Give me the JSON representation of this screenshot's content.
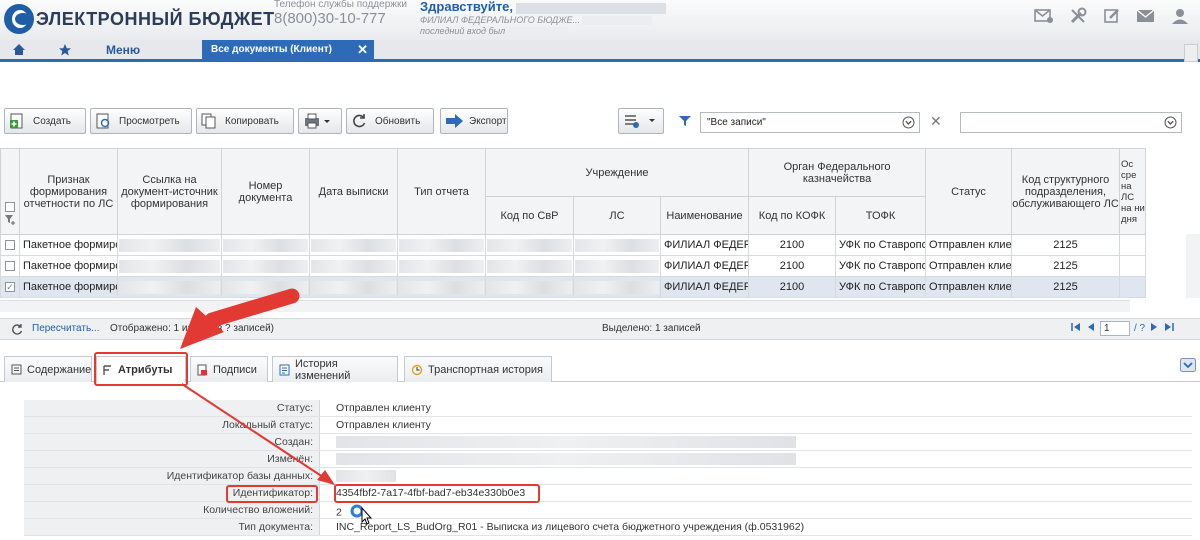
{
  "header": {
    "logo_text": "ЭЛЕКТРОННЫЙ БЮДЖЕТ",
    "support_label": "Телефон службы поддержки",
    "support_phone": "8(800)30-10-777",
    "greeting": "Здравствуйте,",
    "org": "ФИЛИАЛ ФЕДЕРАЛЬНОГО БЮДЖЕ...",
    "last_login_label": "последний вход был"
  },
  "nav": {
    "menu_label": "Меню",
    "active_tab_label": "Все документы (Клиент)",
    "close_glyph": "✕"
  },
  "toolbar": {
    "create": "Создать",
    "view": "Просмотреть",
    "copy": "Копировать",
    "refresh": "Обновить",
    "export": "Экспорт",
    "filter_value": "\"Все записи\"",
    "clear_glyph": "✕"
  },
  "grid": {
    "headers": {
      "sign": "Признак формирования отчетности по ЛС",
      "link": "Ссылка на документ-источник формирования",
      "doc_number": "Номер документа",
      "date": "Дата выписки",
      "report_type": "Тип отчета",
      "institution": "Учреждение",
      "svr_code": "Код по СвР",
      "ls": "ЛС",
      "name": "Наименование",
      "treasury": "Орган Федерального казначейства",
      "kofk_code": "Код по КОФК",
      "tofk": "ТОФК",
      "status": "Статус",
      "struct_code": "Код структурного подразделения, обслуживающего ЛС",
      "extra": "Ос сре на ЛС на ни дня"
    },
    "rows": [
      {
        "sign": "Пакетное формиро",
        "name": "ФИЛИАЛ ФЕДЕР",
        "kofk": "2100",
        "tofk": "УФК по Ставропо",
        "status": "Отправлен клиен",
        "struct": "2125",
        "checked": false
      },
      {
        "sign": "Пакетное формиро",
        "name": "ФИЛИАЛ ФЕДЕР",
        "kofk": "2100",
        "tofk": "УФК по Ставропо",
        "status": "Отправлен клиен",
        "struct": "2125",
        "checked": false
      },
      {
        "sign": "Пакетное формиро",
        "name": "ФИЛИАЛ ФЕДЕР",
        "kofk": "2100",
        "tofk": "УФК по Ставропо",
        "status": "Отправлен клиен",
        "struct": "2125",
        "checked": true
      }
    ]
  },
  "statusbar": {
    "recalc": "Пересчитать...",
    "shown_prefix": "Отображено: 1 из",
    "shown_suffix": "(20 из ? записей)",
    "selected": "Выделено: 1 записей",
    "page_value": "1",
    "page_total": "/ ?"
  },
  "detail_tabs": [
    {
      "label": "Содержание",
      "icon": "content-icon"
    },
    {
      "label": "Атрибуты",
      "icon": "attributes-icon"
    },
    {
      "label": "Подписи",
      "icon": "signature-icon"
    },
    {
      "label": "История изменений",
      "icon": "history-icon"
    },
    {
      "label": "Транспортная история",
      "icon": "transport-icon"
    }
  ],
  "attributes": {
    "status_label": "Статус:",
    "status_value": "Отправлен клиенту",
    "local_status_label": "Локальный статус:",
    "local_status_value": "Отправлен клиенту",
    "created_label": "Создан:",
    "modified_label": "Изменён:",
    "db_id_label": "Идентификатор базы данных:",
    "identifier_label": "Идентификатор:",
    "identifier_value": "4354fbf2-7a17-4fbf-bad7-eb34e330b0e3",
    "attachments_label": "Количество вложений:",
    "attachments_value": "2",
    "doc_type_label": "Тип документа:",
    "doc_type_value": "INC_Report_LS_BudOrg_R01 - Выписка из лицевого счета бюджетного учреждения (ф.0531962)"
  },
  "colors": {
    "brand_blue": "#2d6ab7",
    "annotation_red": "#e23a33"
  }
}
